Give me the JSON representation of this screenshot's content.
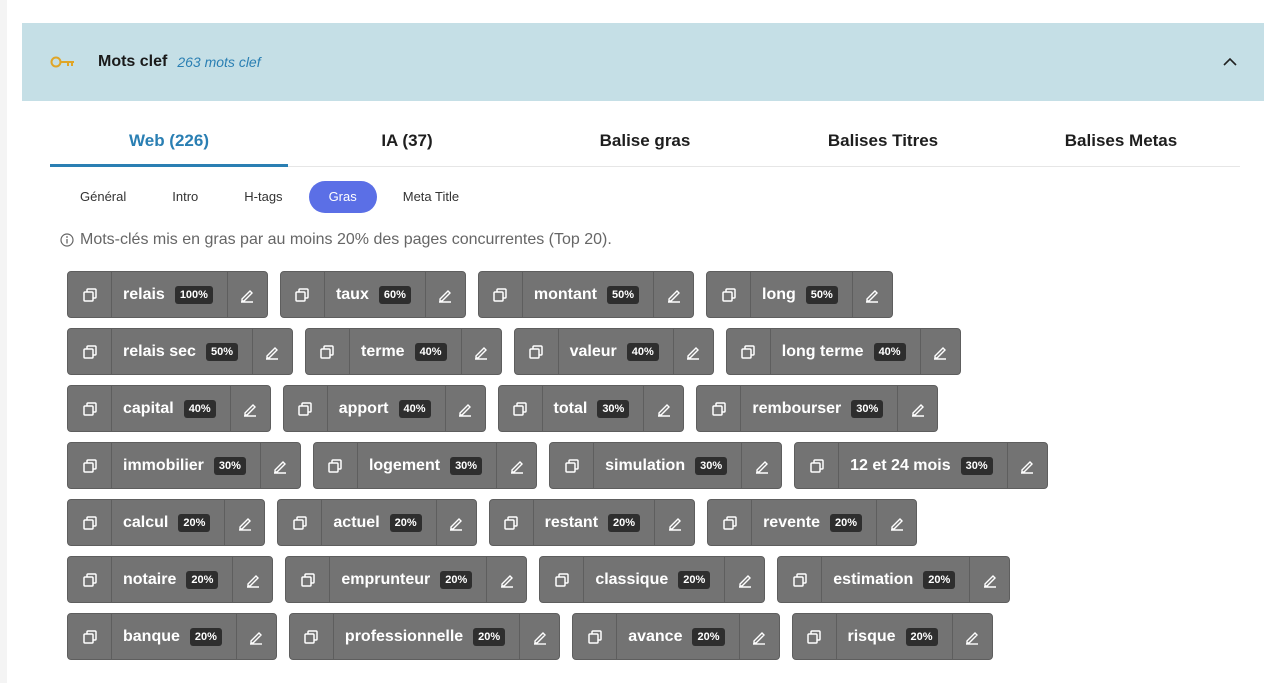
{
  "header": {
    "title": "Mots clef",
    "count": "263 mots clef",
    "icon": "key-icon",
    "accent": "#e0a526"
  },
  "tabs": [
    {
      "label": "Web (226)",
      "active": true
    },
    {
      "label": "IA (37)",
      "active": false
    },
    {
      "label": "Balise gras",
      "active": false
    },
    {
      "label": "Balises Titres",
      "active": false
    },
    {
      "label": "Balises Metas",
      "active": false
    }
  ],
  "subtabs": [
    {
      "label": "Général",
      "active": false
    },
    {
      "label": "Intro",
      "active": false
    },
    {
      "label": "H-tags",
      "active": false
    },
    {
      "label": "Gras",
      "active": true
    },
    {
      "label": "Meta Title",
      "active": false
    }
  ],
  "info": "Mots-clés mis en gras par au moins 20% des pages concurrentes (Top 20).",
  "keywords": [
    [
      {
        "word": "relais",
        "pct": "100%"
      },
      {
        "word": "taux",
        "pct": "60%"
      },
      {
        "word": "montant",
        "pct": "50%"
      },
      {
        "word": "long",
        "pct": "50%"
      }
    ],
    [
      {
        "word": "relais sec",
        "pct": "50%"
      },
      {
        "word": "terme",
        "pct": "40%"
      },
      {
        "word": "valeur",
        "pct": "40%"
      },
      {
        "word": "long terme",
        "pct": "40%"
      }
    ],
    [
      {
        "word": "capital",
        "pct": "40%"
      },
      {
        "word": "apport",
        "pct": "40%"
      },
      {
        "word": "total",
        "pct": "30%"
      },
      {
        "word": "rembourser",
        "pct": "30%"
      }
    ],
    [
      {
        "word": "immobilier",
        "pct": "30%"
      },
      {
        "word": "logement",
        "pct": "30%"
      },
      {
        "word": "simulation",
        "pct": "30%"
      },
      {
        "word": "12 et 24 mois",
        "pct": "30%"
      }
    ],
    [
      {
        "word": "calcul",
        "pct": "20%"
      },
      {
        "word": "actuel",
        "pct": "20%"
      },
      {
        "word": "restant",
        "pct": "20%"
      },
      {
        "word": "revente",
        "pct": "20%"
      }
    ],
    [
      {
        "word": "notaire",
        "pct": "20%"
      },
      {
        "word": "emprunteur",
        "pct": "20%"
      },
      {
        "word": "classique",
        "pct": "20%"
      },
      {
        "word": "estimation",
        "pct": "20%"
      }
    ],
    [
      {
        "word": "banque",
        "pct": "20%"
      },
      {
        "word": "professionnelle",
        "pct": "20%"
      },
      {
        "word": "avance",
        "pct": "20%"
      },
      {
        "word": "risque",
        "pct": "20%"
      }
    ]
  ],
  "colors": {
    "header_bg": "#c5dfe6",
    "tab_active": "#2a7fb3",
    "subtab_active": "#5b6fe6",
    "chip_bg": "#737373"
  }
}
